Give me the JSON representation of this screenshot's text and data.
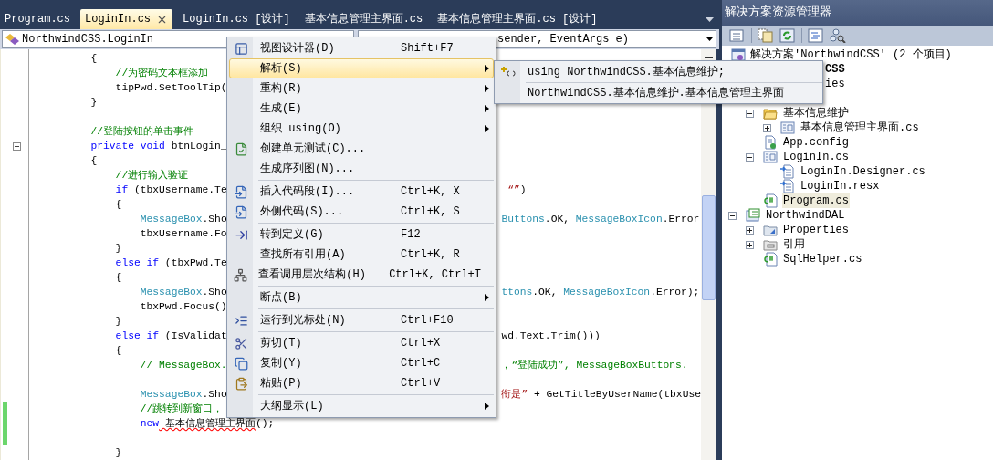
{
  "editor_tabs": [
    {
      "label": "Program.cs",
      "selected": false
    },
    {
      "label": "LoginIn.cs",
      "selected": true
    },
    {
      "label": "LoginIn.cs [设计]",
      "selected": false
    },
    {
      "label": "基本信息管理主界面.cs",
      "selected": false
    },
    {
      "label": "基本信息管理主界面.cs [设计]",
      "selected": false
    }
  ],
  "type_combo": {
    "value": "NorthwindCSS.LoginIn"
  },
  "member_combo": {
    "value": "sender, EventArgs e)"
  },
  "code_lines": [
    {
      "changed": false,
      "fold": false,
      "left": [
        {
          "t": "    {",
          "kind": "plain"
        }
      ]
    },
    {
      "changed": false,
      "fold": false,
      "left": [
        {
          "t": "        //为密码文本框添加",
          "kind": "comment"
        }
      ]
    },
    {
      "changed": false,
      "fold": false,
      "left": [
        {
          "t": "        tipPwd.SetToolTip(",
          "kind": "plain"
        }
      ]
    },
    {
      "changed": false,
      "fold": false,
      "left": [
        {
          "t": "    }",
          "kind": "plain"
        }
      ]
    },
    {
      "changed": false,
      "fold": false
    },
    {
      "changed": false,
      "fold": false,
      "left": [
        {
          "t": "    //登陆按钮的单击事件",
          "kind": "comment"
        }
      ]
    },
    {
      "changed": false,
      "fold": true,
      "left": [
        {
          "t": "    private",
          "kind": "keyword"
        },
        {
          "t": " void",
          "kind": "keyword"
        },
        {
          "t": " btnLogin_",
          "kind": "plain"
        }
      ]
    },
    {
      "changed": false,
      "fold": false,
      "left": [
        {
          "t": "    {",
          "kind": "plain"
        }
      ]
    },
    {
      "changed": false,
      "fold": false,
      "left": [
        {
          "t": "        //进行输入验证",
          "kind": "comment"
        }
      ]
    },
    {
      "changed": false,
      "fold": false,
      "left": [
        {
          "t": "        if",
          "kind": "keyword"
        },
        {
          "t": " (tbxUsername.Te",
          "kind": "plain"
        }
      ],
      "right": [
        {
          "t": " “”",
          "kind": "string"
        },
        {
          "t": ")",
          "kind": "plain"
        }
      ]
    },
    {
      "changed": false,
      "fold": false,
      "left": [
        {
          "t": "        {",
          "kind": "plain"
        }
      ]
    },
    {
      "changed": false,
      "fold": false,
      "left": [
        {
          "t": "            MessageBox",
          "kind": "type"
        },
        {
          "t": ".Sho",
          "kind": "plain"
        }
      ],
      "right": [
        {
          "t": "Buttons",
          "kind": "type"
        },
        {
          "t": ".OK, ",
          "kind": "plain"
        },
        {
          "t": "MessageBoxIcon",
          "kind": "type"
        },
        {
          "t": ".Error",
          "kind": "plain"
        }
      ]
    },
    {
      "changed": false,
      "fold": false,
      "left": [
        {
          "t": "            tbxUsername.Fo",
          "kind": "plain"
        }
      ]
    },
    {
      "changed": false,
      "fold": false,
      "left": [
        {
          "t": "        }",
          "kind": "plain"
        }
      ]
    },
    {
      "changed": false,
      "fold": false,
      "left": [
        {
          "t": "        else",
          "kind": "keyword"
        },
        {
          "t": " if",
          "kind": "keyword"
        },
        {
          "t": " (tbxPwd.Te",
          "kind": "plain"
        }
      ]
    },
    {
      "changed": false,
      "fold": false,
      "left": [
        {
          "t": "        {",
          "kind": "plain"
        }
      ]
    },
    {
      "changed": false,
      "fold": false,
      "left": [
        {
          "t": "            MessageBox",
          "kind": "type"
        },
        {
          "t": ".Sho",
          "kind": "plain"
        }
      ],
      "right": [
        {
          "t": "ttons",
          "kind": "type"
        },
        {
          "t": ".OK, ",
          "kind": "plain"
        },
        {
          "t": "MessageBoxIcon",
          "kind": "type"
        },
        {
          "t": ".Error);",
          "kind": "plain"
        }
      ]
    },
    {
      "changed": false,
      "fold": false,
      "left": [
        {
          "t": "            tbxPwd.Focus()",
          "kind": "plain"
        }
      ]
    },
    {
      "changed": false,
      "fold": false,
      "left": [
        {
          "t": "        }",
          "kind": "plain"
        }
      ]
    },
    {
      "changed": false,
      "fold": false,
      "left": [
        {
          "t": "        else",
          "kind": "keyword"
        },
        {
          "t": " if",
          "kind": "keyword"
        },
        {
          "t": " (IsValidat",
          "kind": "plain"
        }
      ],
      "right": [
        {
          "t": "wd.Text.Trim()))",
          "kind": "plain"
        }
      ]
    },
    {
      "changed": false,
      "fold": false,
      "left": [
        {
          "t": "        {",
          "kind": "plain"
        }
      ]
    },
    {
      "changed": false,
      "fold": false,
      "left": [
        {
          "t": "            // MessageBox.",
          "kind": "comment"
        }
      ],
      "right": [
        {
          "t": "，“登陆成功”, MessageBoxButtons.",
          "kind": "comment"
        }
      ]
    },
    {
      "changed": false,
      "fold": false
    },
    {
      "changed": false,
      "fold": false,
      "left": [
        {
          "t": "            MessageBox",
          "kind": "type"
        },
        {
          "t": ".Sho",
          "kind": "plain"
        }
      ],
      "right": [
        {
          "t": "衔是”",
          "kind": "string"
        },
        {
          "t": " + GetTitleByUserName(tbxUse",
          "kind": "plain"
        }
      ]
    },
    {
      "changed": true,
      "fold": false,
      "left": [
        {
          "t": "            //跳转到新窗口，",
          "kind": "comment"
        }
      ]
    },
    {
      "changed": true,
      "fold": false,
      "left": [
        {
          "t": "            new",
          "kind": "keyword"
        },
        {
          "t": " 基本信息管理主界面",
          "kind": "error"
        },
        {
          "t": "();",
          "kind": "plain"
        }
      ]
    },
    {
      "changed": true,
      "fold": false
    },
    {
      "changed": false,
      "fold": false,
      "left": [
        {
          "t": "        }",
          "kind": "plain"
        }
      ]
    }
  ],
  "context_menu": {
    "items": [
      {
        "kind": "command",
        "label": "视图设计器(D)",
        "shortcut": "Shift+F7",
        "selected": false
      },
      {
        "kind": "submenu",
        "label": "解析(S)",
        "selected": true
      },
      {
        "kind": "submenu",
        "label": "重构(R)",
        "selected": false
      },
      {
        "kind": "submenu",
        "label": "生成(E)",
        "selected": false
      },
      {
        "kind": "submenu",
        "label": "组织 using(O)",
        "selected": false
      },
      {
        "kind": "command",
        "label": "创建单元测试(C)...",
        "selected": false
      },
      {
        "kind": "command",
        "label": "生成序列图(N)...",
        "selected": false
      },
      {
        "kind": "separator"
      },
      {
        "kind": "command",
        "label": "插入代码段(I)...",
        "shortcut": "Ctrl+K, X",
        "selected": false
      },
      {
        "kind": "command",
        "label": "外侧代码(S)...",
        "shortcut": "Ctrl+K, S",
        "selected": false
      },
      {
        "kind": "separator"
      },
      {
        "kind": "command",
        "label": "转到定义(G)",
        "shortcut": "F12",
        "selected": false
      },
      {
        "kind": "command",
        "label": "查找所有引用(A)",
        "shortcut": "Ctrl+K, R",
        "selected": false
      },
      {
        "kind": "command",
        "label": "查看调用层次结构(H)",
        "shortcut": "Ctrl+K, Ctrl+T",
        "selected": false
      },
      {
        "kind": "separator"
      },
      {
        "kind": "submenu",
        "label": "断点(B)",
        "selected": false
      },
      {
        "kind": "separator"
      },
      {
        "kind": "command",
        "label": "运行到光标处(N)",
        "shortcut": "Ctrl+F10",
        "selected": false
      },
      {
        "kind": "separator"
      },
      {
        "kind": "command",
        "label": "剪切(T)",
        "shortcut": "Ctrl+X",
        "selected": false
      },
      {
        "kind": "command",
        "label": "复制(Y)",
        "shortcut": "Ctrl+C",
        "selected": false
      },
      {
        "kind": "command",
        "label": "粘贴(P)",
        "shortcut": "Ctrl+V",
        "selected": false
      },
      {
        "kind": "separator"
      },
      {
        "kind": "submenu",
        "label": "大纲显示(L)",
        "selected": false
      }
    ]
  },
  "submenu": {
    "items": [
      {
        "label": "using NorthwindCSS.基本信息维护;",
        "selected": false
      },
      {
        "label": "NorthwindCSS.基本信息维护.基本信息管理主界面",
        "selected": false
      }
    ]
  },
  "solution_explorer": {
    "title": "解决方案资源管理器",
    "tree": [
      {
        "kind": "solution",
        "label": "解决方案'NorthwindCSS' (2 个项目)",
        "expandable": false,
        "selected": false,
        "children": [
          {
            "kind": "project-fragment",
            "label": "CSS",
            "expandable": false,
            "selected": false,
            "children": [
              {
                "kind": "item-fragment",
                "label": "ies",
                "expandable": false,
                "selected": false
              },
              {
                "kind": "folder",
                "label": "基本信息维护",
                "expandable": true,
                "expanded": true,
                "selected": false,
                "children": [
                  {
                    "kind": "form",
                    "label": "基本信息管理主界面.cs",
                    "expandable": true,
                    "expanded": false,
                    "selected": false
                  }
                ]
              },
              {
                "kind": "config",
                "label": "App.config",
                "expandable": false,
                "selected": false
              },
              {
                "kind": "form",
                "label": "LoginIn.cs",
                "expandable": true,
                "expanded": true,
                "selected": false,
                "children": [
                  {
                    "kind": "code",
                    "label": "LoginIn.Designer.cs",
                    "expandable": false,
                    "selected": false
                  },
                  {
                    "kind": "code",
                    "label": "LoginIn.resx",
                    "expandable": false,
                    "selected": false
                  }
                ]
              },
              {
                "kind": "csharp",
                "label": "Program.cs",
                "expandable": false,
                "selected": true
              }
            ]
          },
          {
            "kind": "project",
            "label": "NorthwindDAL",
            "expandable": true,
            "expanded": true,
            "selected": false,
            "children": [
              {
                "kind": "properties",
                "label": "Properties",
                "expandable": true,
                "expanded": false,
                "selected": false
              },
              {
                "kind": "references",
                "label": "引用",
                "expandable": true,
                "expanded": false,
                "selected": false
              },
              {
                "kind": "csharp",
                "label": "SqlHelper.cs",
                "expandable": false,
                "selected": false
              }
            ]
          }
        ]
      }
    ]
  }
}
